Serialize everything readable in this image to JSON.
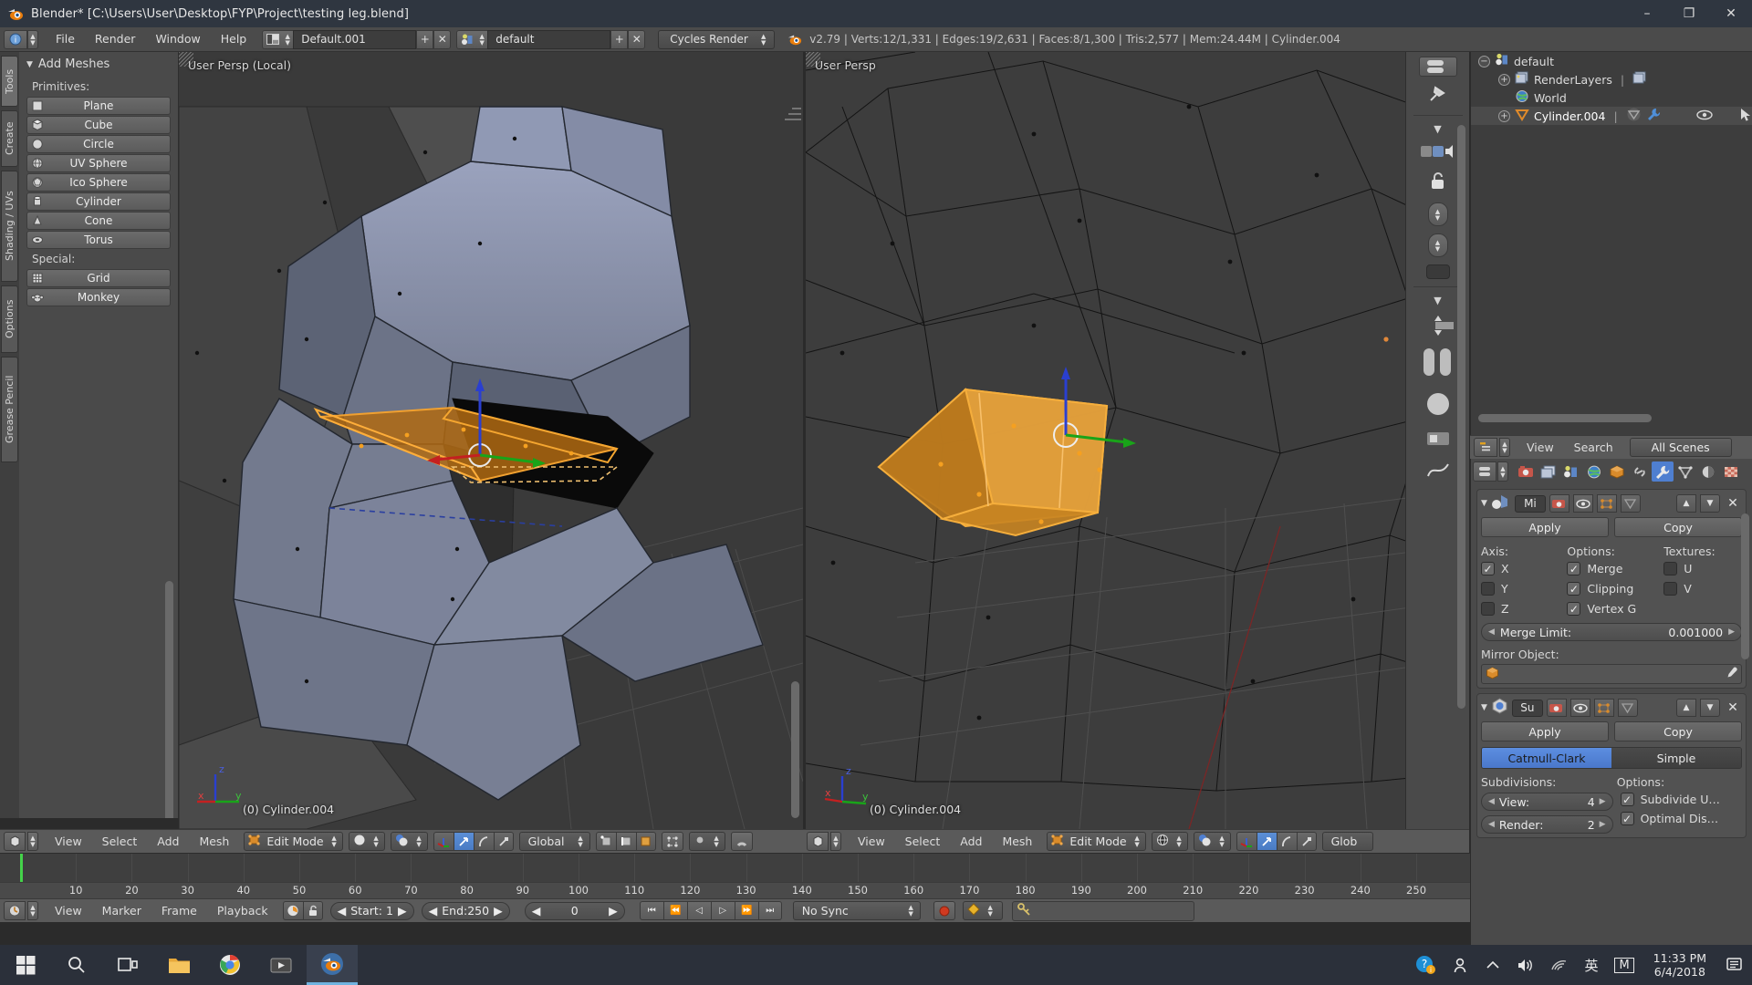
{
  "window": {
    "title": "Blender* [C:\\Users\\User\\Desktop\\FYP\\Project\\testing leg.blend]",
    "minimize": "–",
    "maximize": "❐",
    "close": "✕"
  },
  "topbar": {
    "menus": [
      "File",
      "Render",
      "Window",
      "Help"
    ],
    "screen_layout": "Default.001",
    "scene_name": "default",
    "render_engine": "Cycles Render",
    "stats": "v2.79 | Verts:12/1,331 | Edges:19/2,631 | Faces:8/1,300 | Tris:2,577 | Mem:24.44M | Cylinder.004",
    "add_label": "+",
    "x_label": "✕"
  },
  "tool_tabs": [
    {
      "label": "Tools",
      "active": true
    },
    {
      "label": "Create",
      "active": false
    },
    {
      "label": "Shading / UVs",
      "active": false
    },
    {
      "label": "Options",
      "active": false
    },
    {
      "label": "Grease Pencil",
      "active": false
    }
  ],
  "toolshelf": {
    "panel_title": "Add Meshes",
    "primitives_label": "Primitives:",
    "primitives": [
      "Plane",
      "Cube",
      "Circle",
      "UV Sphere",
      "Ico Sphere",
      "Cylinder",
      "Cone",
      "Torus"
    ],
    "special_label": "Special:",
    "special": [
      "Grid",
      "Monkey"
    ]
  },
  "viewport_left": {
    "view_label": "User Persp (Local)",
    "object_label": "(0) Cylinder.004",
    "axis": {
      "x": "x",
      "y": "y",
      "z": "z"
    },
    "header": {
      "menus": [
        "View",
        "Select",
        "Add",
        "Mesh"
      ],
      "mode": "Edit Mode",
      "transform_orientation": "Global"
    }
  },
  "viewport_right": {
    "view_label": "User Persp",
    "object_label": "(0) Cylinder.004",
    "axis": {
      "x": "x",
      "y": "y",
      "z": "z"
    },
    "header": {
      "menus": [
        "View",
        "Select",
        "Add",
        "Mesh"
      ],
      "mode": "Edit Mode",
      "transform_orientation": "Glob"
    }
  },
  "outliner": {
    "header": {
      "menus": [
        "View",
        "Search"
      ],
      "display_mode": "All Scenes"
    },
    "rows": [
      {
        "indent": 0,
        "label": "default",
        "expander": "−",
        "icon": "scene-icon"
      },
      {
        "indent": 1,
        "label": "RenderLayers",
        "expander": "+",
        "icon": "renderlayers-icon"
      },
      {
        "indent": 1,
        "label": "World",
        "expander": "",
        "icon": "world-icon"
      },
      {
        "indent": 1,
        "label": "Cylinder.004",
        "expander": "+",
        "icon": "mesh-icon"
      }
    ]
  },
  "properties": {
    "tabs": [
      {
        "name": "render-tab",
        "on": false
      },
      {
        "name": "renderlayers-tab",
        "on": false
      },
      {
        "name": "scene-tab",
        "on": false
      },
      {
        "name": "world-tab",
        "on": false
      },
      {
        "name": "object-tab",
        "on": false
      },
      {
        "name": "constraints-tab",
        "on": false
      },
      {
        "name": "modifiers-tab",
        "on": true
      },
      {
        "name": "data-tab",
        "on": false
      },
      {
        "name": "material-tab",
        "on": false
      },
      {
        "name": "texture-tab",
        "on": false
      }
    ],
    "mirror_modifier": {
      "name": "Mi",
      "apply_label": "Apply",
      "copy_label": "Copy",
      "axis_label": "Axis:",
      "options_label": "Options:",
      "textures_label": "Textures:",
      "axis": [
        {
          "label": "X",
          "checked": true
        },
        {
          "label": "Y",
          "checked": false
        },
        {
          "label": "Z",
          "checked": false
        }
      ],
      "options": [
        {
          "label": "Merge",
          "checked": true
        },
        {
          "label": "Clipping",
          "checked": true
        },
        {
          "label": "Vertex G",
          "checked": true
        }
      ],
      "textures": [
        {
          "label": "U",
          "checked": false
        },
        {
          "label": "V",
          "checked": false
        }
      ],
      "merge_limit_label": "Merge Limit:",
      "merge_limit_value": "0.001000",
      "mirror_object_label": "Mirror Object:",
      "mirror_object_value": ""
    },
    "subsurf_modifier": {
      "name": "Su",
      "apply_label": "Apply",
      "copy_label": "Copy",
      "type_catmull": "Catmull-Clark",
      "type_simple": "Simple",
      "type_selected": "Catmull-Clark",
      "subdivisions_label": "Subdivisions:",
      "options_label": "Options:",
      "view_label": "View:",
      "view_value": "4",
      "render_label": "Render:",
      "render_value": "2",
      "opt_subdivide": {
        "label": "Subdivide U…",
        "checked": true
      },
      "opt_optimal": {
        "label": "Optimal Dis…",
        "checked": true
      }
    }
  },
  "timeline": {
    "ticks": [
      10,
      20,
      30,
      40,
      50,
      60,
      70,
      80,
      90,
      100,
      110,
      120,
      130,
      140,
      150,
      160,
      170,
      180,
      190,
      200,
      210,
      220,
      230,
      240,
      250
    ],
    "tick_min": 0,
    "tick_max": 258,
    "current_frame": 0,
    "header": {
      "menus": [
        "View",
        "Marker",
        "Frame",
        "Playback"
      ],
      "start_label": "Start:",
      "start_value": "1",
      "end_label": "End:",
      "end_value": "250",
      "frame_value": "0",
      "sync_mode": "No Sync",
      "transport": [
        "⏮",
        "⏪",
        "◁",
        "▷",
        "⏩",
        "⏭"
      ]
    }
  },
  "taskbar": {
    "items": [
      {
        "name": "start-button",
        "icon": "windows-logo"
      },
      {
        "name": "search-button",
        "icon": "search-icon"
      },
      {
        "name": "task-view-button",
        "icon": "task-view-icon"
      },
      {
        "name": "file-explorer-button",
        "icon": "folder-icon"
      },
      {
        "name": "chrome-button",
        "icon": "chrome-icon"
      },
      {
        "name": "media-button",
        "icon": "media-icon"
      },
      {
        "name": "blender-button",
        "icon": "blender-icon",
        "active": true
      }
    ],
    "tray": {
      "help_icon": "question-icon",
      "people_icon": "people-icon",
      "chevron_icon": "chevron-up-icon",
      "volume_icon": "volume-icon",
      "network_icon": "wifi-icon",
      "ime_label": "英",
      "ime_mode": "M",
      "time": "11:33 PM",
      "date": "6/4/2018",
      "notifications_icon": "notification-icon"
    }
  },
  "colors": {
    "accent_blue": "#4f7fd0",
    "selection_orange": "#e8a13a",
    "active_orange": "#f5a623",
    "header_gray": "#5a5a5a",
    "panel_gray": "#4a4a4a",
    "viewport_bg": "#3b3b3b",
    "axis_x": "#cc2222",
    "axis_y": "#22aa22",
    "axis_z": "#2222cc"
  }
}
